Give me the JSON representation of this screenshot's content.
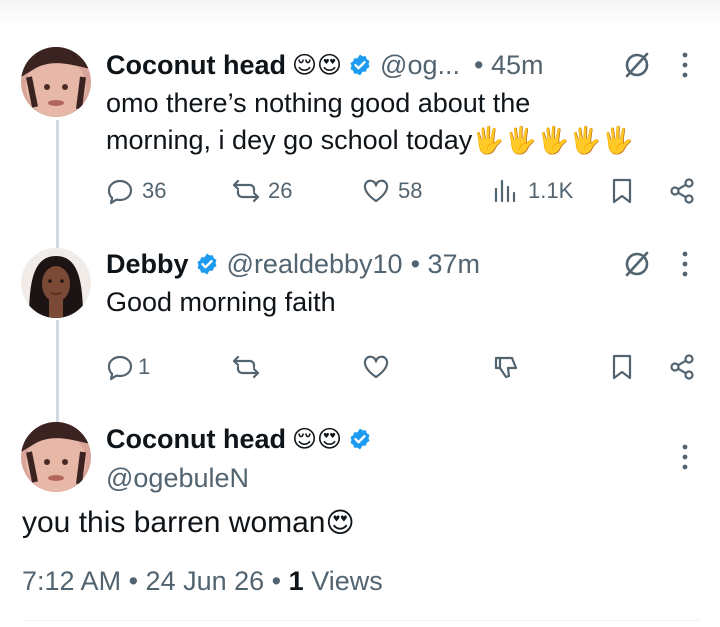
{
  "tweets": [
    {
      "name": "Coconut head",
      "emojis": "😌😍",
      "handle": "@og...",
      "time": "• 45m",
      "text_line1": "omo there’s nothing good about the",
      "text_line2": "morning, i dey go school today",
      "text_emoji": "🖐🖐🖐🖐🖐",
      "replies": "36",
      "retweets": "26",
      "likes": "58",
      "views": "1.1K"
    },
    {
      "name": "Debby",
      "handle": "@realdebby10",
      "time": "• 37m",
      "text": "Good morning faith",
      "replies": "1"
    }
  ],
  "main_tweet": {
    "name": "Coconut head",
    "emojis": "😌😍",
    "handle": "@ogebuleN",
    "text": "you this barren woman",
    "text_emoji": "😍",
    "meta_time": "7:12 AM",
    "meta_date": "24 Jun 26",
    "meta_views_count": "1",
    "meta_views_label": "Views"
  },
  "colors": {
    "verified": "#1d9bf0",
    "secondary_text": "#536471",
    "thread_line": "#cfd9de"
  },
  "icons": [
    "reply-icon",
    "retweet-icon",
    "like-icon",
    "views-icon",
    "bookmark-icon",
    "share-icon",
    "grok-icon",
    "more-icon",
    "verified-badge-icon",
    "dislike-icon"
  ]
}
